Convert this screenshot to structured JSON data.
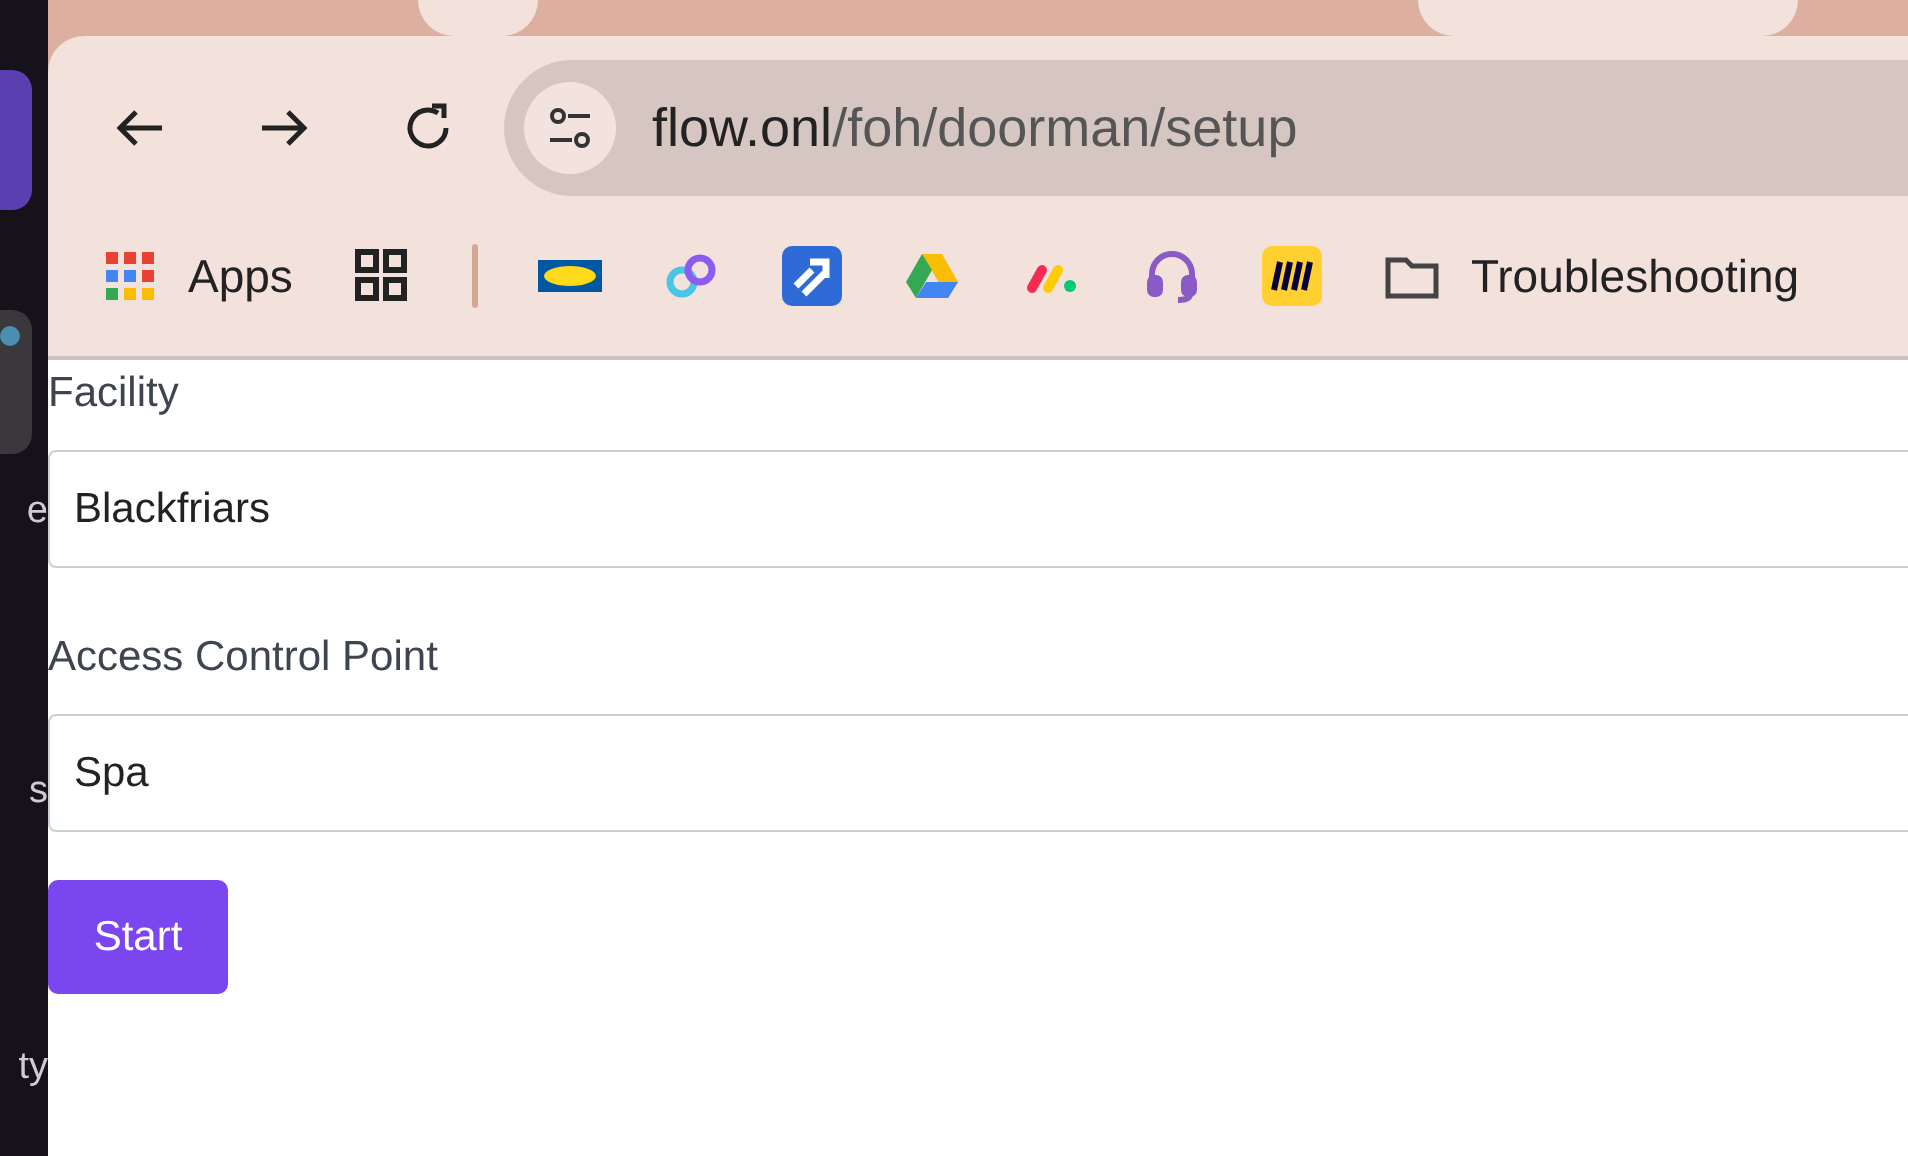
{
  "sidebar": {
    "items": [
      {
        "label": "e"
      },
      {
        "label": "s"
      },
      {
        "label": "ty"
      }
    ]
  },
  "browser": {
    "url_host": "flow.onl",
    "url_path": "/foh/doorman/setup",
    "bookmarks": [
      {
        "kind": "apps",
        "label": "Apps"
      },
      {
        "kind": "grid"
      },
      {
        "kind": "divider"
      },
      {
        "kind": "ikea"
      },
      {
        "kind": "rings"
      },
      {
        "kind": "jira"
      },
      {
        "kind": "drive"
      },
      {
        "kind": "monday"
      },
      {
        "kind": "headset"
      },
      {
        "kind": "miro"
      },
      {
        "kind": "folder",
        "label": "Troubleshooting"
      }
    ]
  },
  "form": {
    "fields": [
      {
        "label": "Facility",
        "value": "Blackfriars"
      },
      {
        "label": "Access Control Point",
        "value": "Spa"
      }
    ],
    "button": "Start"
  }
}
